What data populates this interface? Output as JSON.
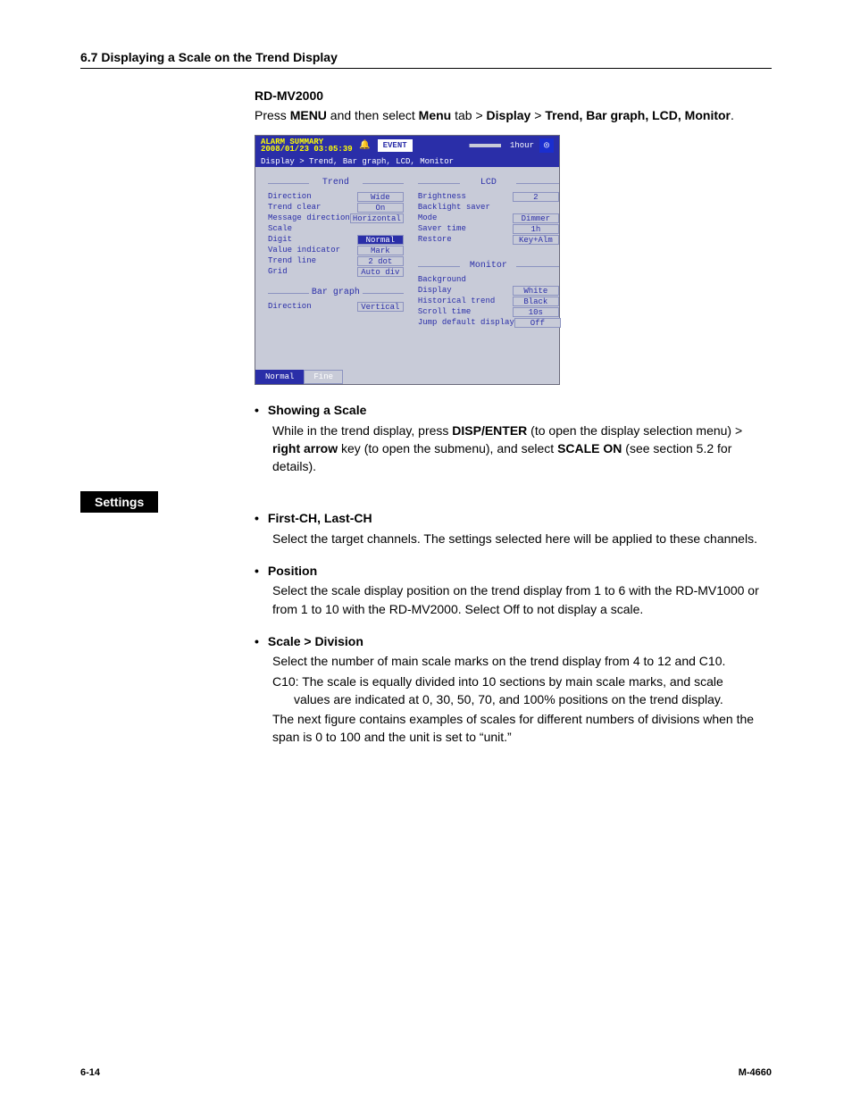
{
  "header": "6.7  Displaying a Scale on the Trend Display",
  "model_title": "RD-MV2000",
  "intro_parts": [
    "Press ",
    "MENU",
    " and then select ",
    "Menu",
    " tab > ",
    "Display",
    " > ",
    "Trend, Bar graph, LCD, Monitor",
    "."
  ],
  "device": {
    "alarm_line1": "ALARM SUMMARY",
    "alarm_line2": "2008/01/23 03:05:39",
    "event": "EVENT",
    "hour": "1hour",
    "crumb": "Display > Trend, Bar graph, LCD, Monitor",
    "groups": {
      "trend": {
        "label": "Trend",
        "rows": [
          {
            "k": "Direction",
            "v": "Wide"
          },
          {
            "k": "Trend clear",
            "v": "On"
          },
          {
            "k": "Message direction",
            "v": "Horizontal"
          },
          {
            "k": "Scale",
            "v": ""
          },
          {
            "k": "Digit",
            "v": "Normal",
            "sel": true
          },
          {
            "k": "Value indicator",
            "v": "Mark"
          },
          {
            "k": "Trend line",
            "v": "2   dot"
          },
          {
            "k": "Grid",
            "v": "Auto  div"
          }
        ]
      },
      "bar": {
        "label": "Bar graph",
        "rows": [
          {
            "k": "Direction",
            "v": "Vertical"
          }
        ]
      },
      "lcd": {
        "label": "LCD",
        "rows": [
          {
            "k": "Brightness",
            "v": "2"
          },
          {
            "k": "Backlight saver",
            "v": ""
          },
          {
            "k": "Mode",
            "v": "Dimmer"
          },
          {
            "k": "Saver time",
            "v": "1h"
          },
          {
            "k": "Restore",
            "v": "Key+Alm"
          }
        ]
      },
      "monitor": {
        "label": "Monitor",
        "rows": [
          {
            "k": "Background",
            "v": ""
          },
          {
            "k": "Display",
            "v": "White"
          },
          {
            "k": "Historical trend",
            "v": "Black"
          },
          {
            "k": "Scroll time",
            "v": "10s"
          },
          {
            "k": "Jump default display",
            "v": "Off"
          }
        ]
      }
    },
    "footer_tabs": [
      "Normal",
      "Fine"
    ]
  },
  "showing_scale": {
    "title": "Showing a Scale",
    "body_parts": [
      "While in the trend display, press ",
      "DISP/ENTER",
      " (to open the display selection menu) > ",
      "right arrow",
      " key (to open the submenu), and select ",
      "SCALE ON",
      " (see section 5.2 for details)."
    ]
  },
  "settings_label": "Settings",
  "settings": [
    {
      "title": "First-CH, Last-CH",
      "body": "Select the target channels. The settings selected here will be applied to these channels."
    },
    {
      "title": "Position",
      "body": "Select the scale display position on the trend display from 1 to 6 with the RD-MV1000 or from 1 to 10 with the RD-MV2000. Select Off to not display a scale."
    },
    {
      "title": "Scale > Division",
      "body": "Select the number of main scale marks on the trend display from 4 to 12 and C10.",
      "body2": "C10: The scale is equally divided into 10 sections by main scale marks, and scale",
      "body3": "values are indicated at 0, 30, 50, 70, and 100% positions on the trend display.",
      "body4": "The next figure contains examples of scales for different numbers of divisions when the span is 0 to 100 and the unit is set to “unit.”"
    }
  ],
  "footer": {
    "page": "6-14",
    "doc": "M-4660"
  }
}
